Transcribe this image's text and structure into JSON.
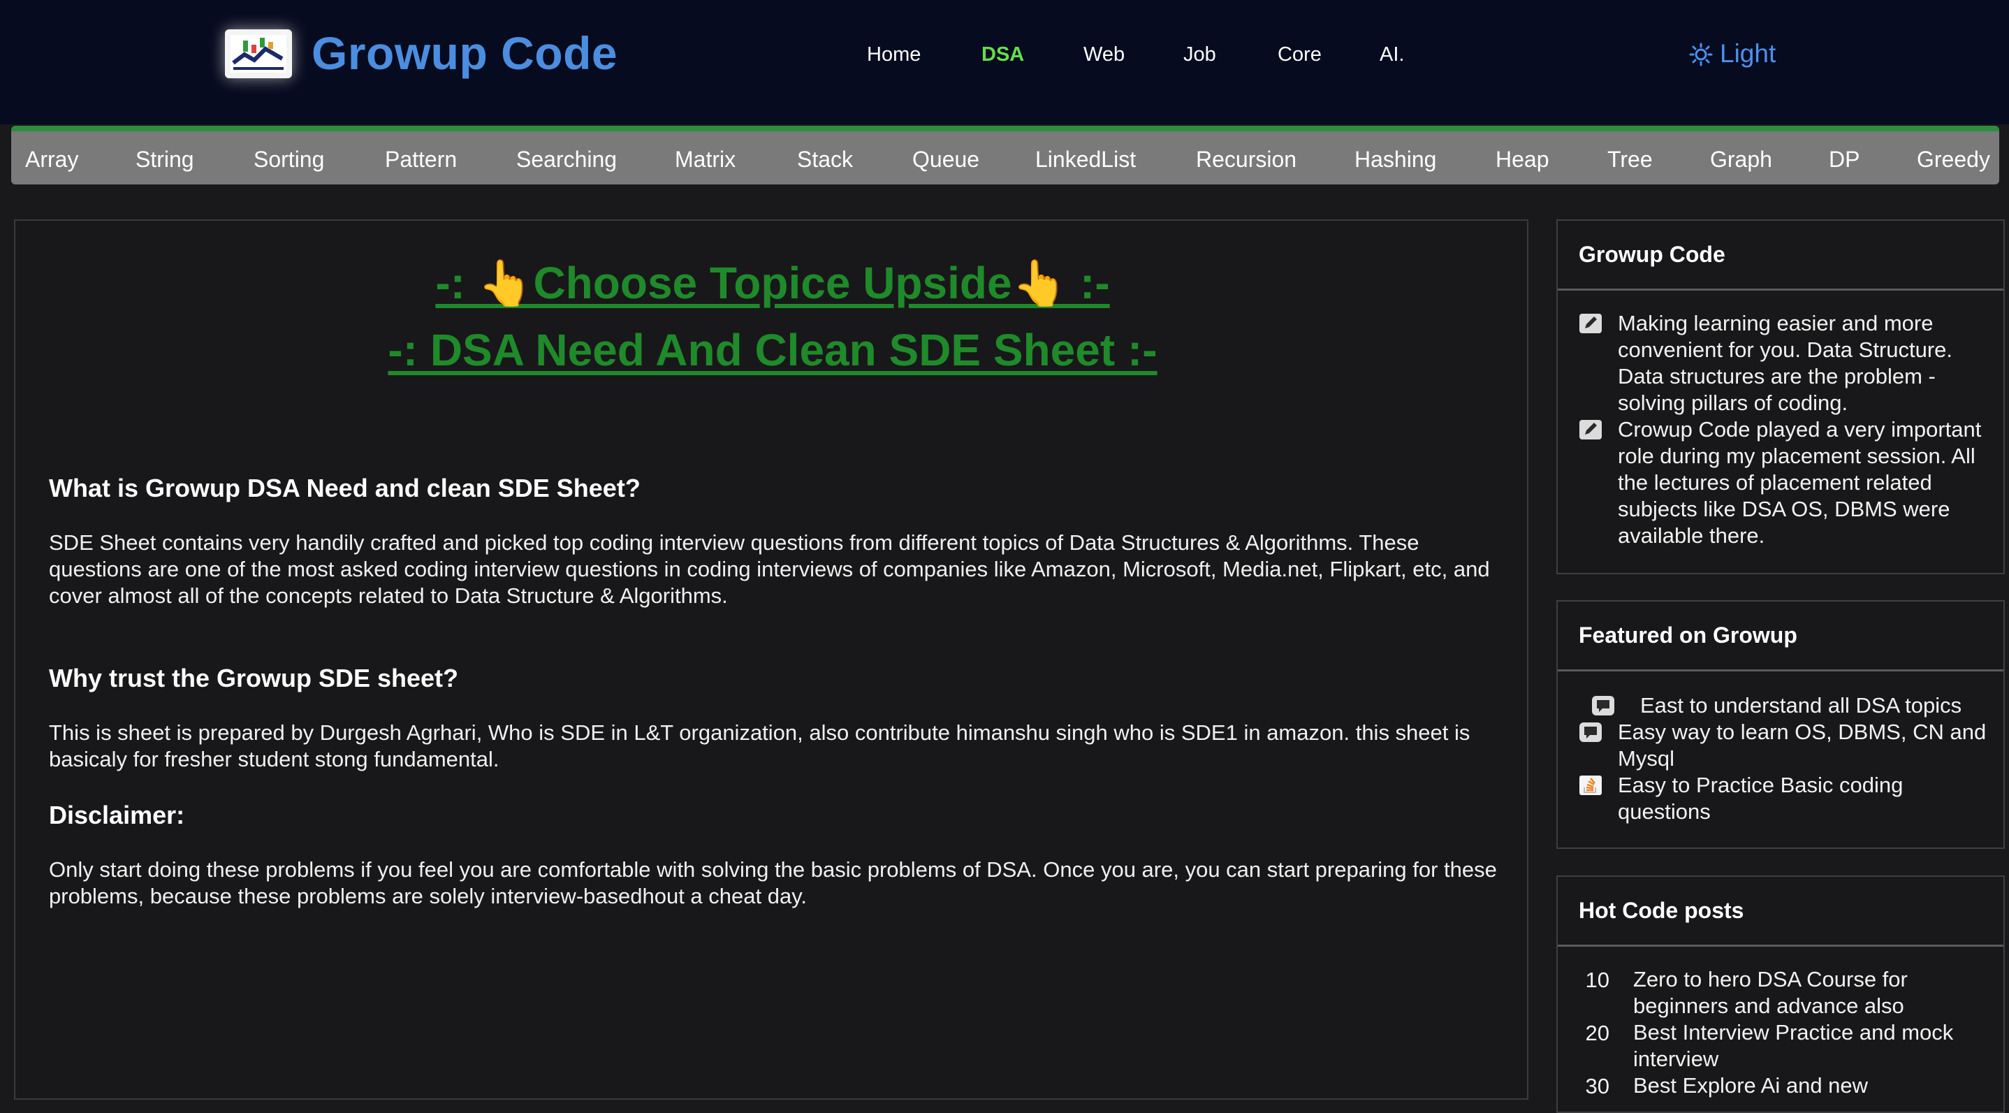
{
  "brand": {
    "name": "Growup Code",
    "logo": "chart-logo-icon"
  },
  "nav": {
    "items": [
      {
        "label": "Home",
        "active": false
      },
      {
        "label": "DSA",
        "active": true
      },
      {
        "label": "Web",
        "active": false
      },
      {
        "label": "Job",
        "active": false
      },
      {
        "label": "Core",
        "active": false
      },
      {
        "label": "AI.",
        "active": false
      }
    ],
    "theme_label": "Light",
    "theme_icon": "sun-icon"
  },
  "categories": [
    "Array",
    "String",
    "Sorting",
    "Pattern",
    "Searching",
    "Matrix",
    "Stack",
    "Queue",
    "LinkedList",
    "Recursion",
    "Hashing",
    "Heap",
    "Tree",
    "Graph",
    "DP",
    "Greedy"
  ],
  "main": {
    "hero_line1": "-: 👆Choose Topice Upside👆 :-",
    "hero_line2": "-: DSA Need And Clean SDE Sheet :-",
    "sections": [
      {
        "heading": "What is Growup DSA Need and clean SDE Sheet?",
        "body": "SDE Sheet contains very handily crafted and picked top coding interview questions from different topics of Data Structures & Algorithms. These questions are one of the most asked coding interview questions in coding interviews of companies like Amazon, Microsoft, Media.net, Flipkart, etc, and cover almost all of the concepts related to Data Structure & Algorithms."
      },
      {
        "heading": "Why trust the Growup SDE sheet?",
        "body": "This is sheet is prepared by Durgesh Agrhari, Who is SDE in L&T organization, also contribute himanshu singh who is SDE1 in amazon. this sheet is basicaly for fresher student stong fundamental."
      },
      {
        "heading": "Disclaimer:",
        "body": "Only start doing these problems if you feel you are comfortable with solving the basic problems of DSA. Once you are, you can start preparing for these problems, because these problems are solely interview-basedhout a cheat day."
      }
    ]
  },
  "sidebar": {
    "about": {
      "title": "Growup Code",
      "items": [
        {
          "icon": "pencil-square-icon",
          "text": "Making learning easier and more convenient for you. Data Structure. Data structures are the problem - solving pillars of coding."
        },
        {
          "icon": "pencil-square-icon",
          "text": "Crowup Code played a very important role during my placement session. All the lectures of placement related subjects like DSA OS, DBMS were available there."
        }
      ]
    },
    "featured": {
      "title": "Featured on Growup",
      "items": [
        {
          "icon": "chat-bubble-icon",
          "text": "East to understand all DSA topics"
        },
        {
          "icon": "chat-bubble-icon",
          "text": "Easy way to learn OS, DBMS, CN and Mysql"
        },
        {
          "icon": "stack-overflow-icon",
          "text": "Easy to Practice Basic coding questions"
        }
      ]
    },
    "hot": {
      "title": "Hot Code posts",
      "items": [
        {
          "num": "10",
          "text": "Zero to hero DSA Course for beginners and advance also"
        },
        {
          "num": "20",
          "text": "Best Interview Practice and mock interview"
        },
        {
          "num": "30",
          "text": "Best Explore Ai and new"
        }
      ]
    }
  }
}
